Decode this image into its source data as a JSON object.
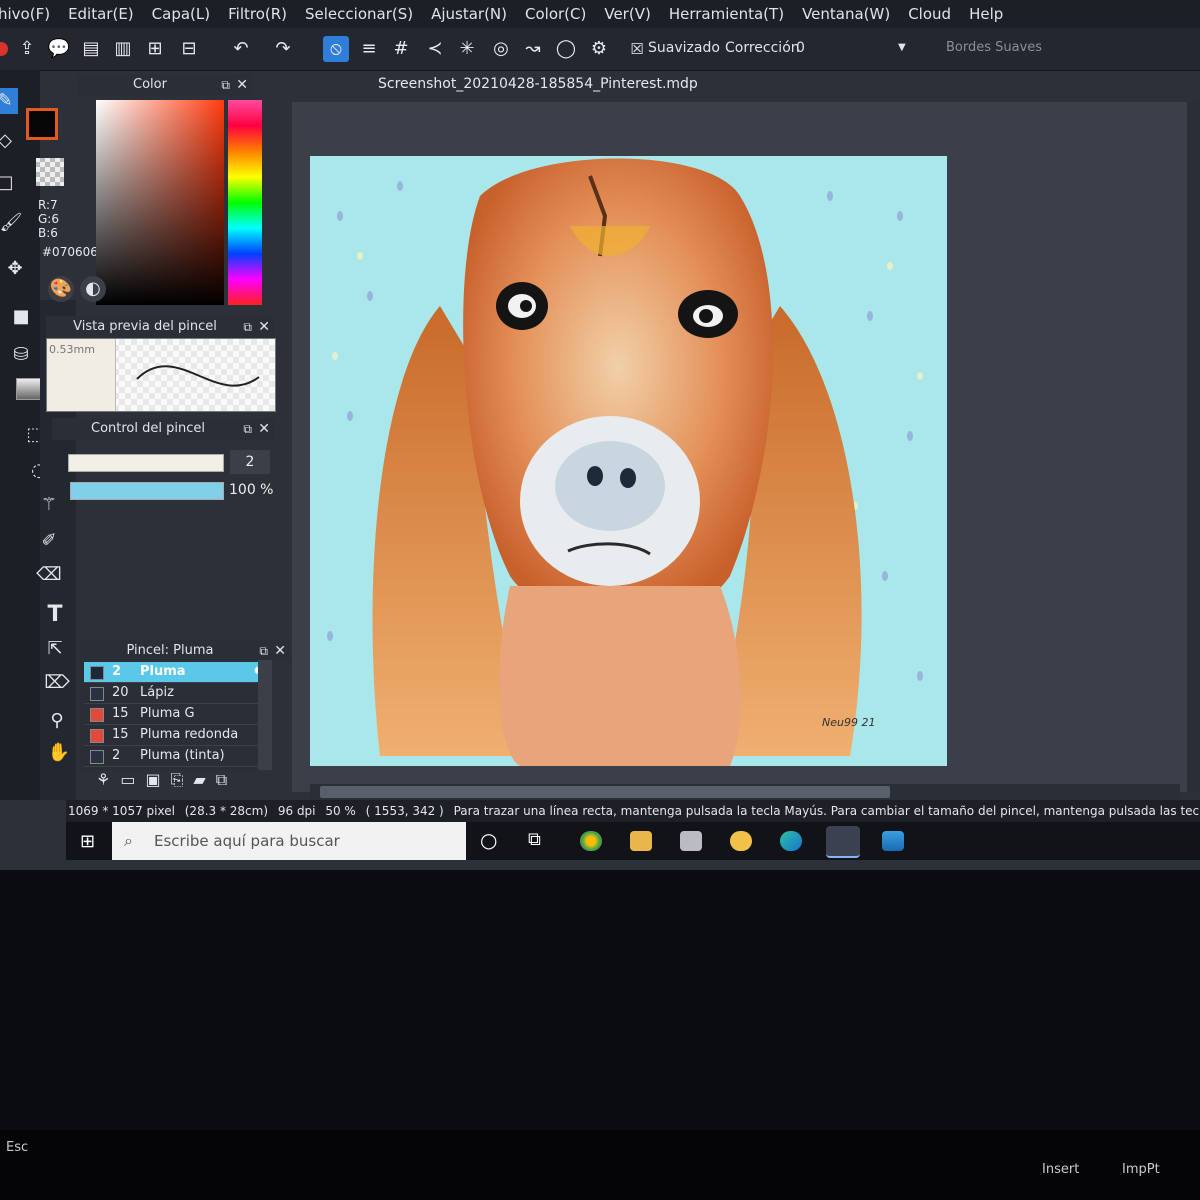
{
  "menu": [
    "hivo(F)",
    "Editar(E)",
    "Capa(L)",
    "Filtro(R)",
    "Seleccionar(S)",
    "Ajustar(N)",
    "Color(C)",
    "Ver(V)",
    "Herramienta(T)",
    "Ventana(W)",
    "Cloud",
    "Help"
  ],
  "toolbar": {
    "smoothing_label": "Suavizado",
    "correction_label": "Corrección",
    "correction_value": "0",
    "soft_edges_label": "Bordes Suaves"
  },
  "color_panel": {
    "title": "Color",
    "r": "R:7",
    "g": "G:6",
    "b": "B:6",
    "hex": "#070606",
    "fg_color": "#070606",
    "accent": "#e25a1c"
  },
  "brush_preview": {
    "title": "Vista previa del pincel",
    "size": "0.53mm"
  },
  "brush_control": {
    "title": "Control del pincel",
    "size_value": "2",
    "opacity_value": "100 %"
  },
  "brush_panel": {
    "title": "Pincel: Pluma",
    "items": [
      {
        "size": "2",
        "name": "Pluma",
        "color": "#1a2a3a"
      },
      {
        "size": "20",
        "name": "Lápiz",
        "color": "#2a3140"
      },
      {
        "size": "15",
        "name": "Pluma G",
        "color": "#e04a3a"
      },
      {
        "size": "15",
        "name": "Pluma redonda",
        "color": "#e04a3a"
      },
      {
        "size": "2",
        "name": "Pluma (tinta)",
        "color": "#2a3140"
      }
    ]
  },
  "document": {
    "title": "Screenshot_20210428-185854_Pinterest.mdp",
    "signature": "Neu99 21"
  },
  "status": {
    "dimensions": "1069 * 1057 pixel",
    "physical": "(28.3 * 28cm)",
    "dpi": "96 dpi",
    "zoom": "50 %",
    "coords": "( 1553, 342 )",
    "hint": "Para trazar una línea recta, mantenga pulsada la tecla Mayús. Para cambiar el tamaño del pincel, mantenga pulsada las teclas Ctrl + Alt y arrastre"
  },
  "taskbar": {
    "search_placeholder": "Escribe aquí para buscar"
  },
  "keyboard": [
    "Esc",
    "Insert",
    "ImpPt"
  ]
}
